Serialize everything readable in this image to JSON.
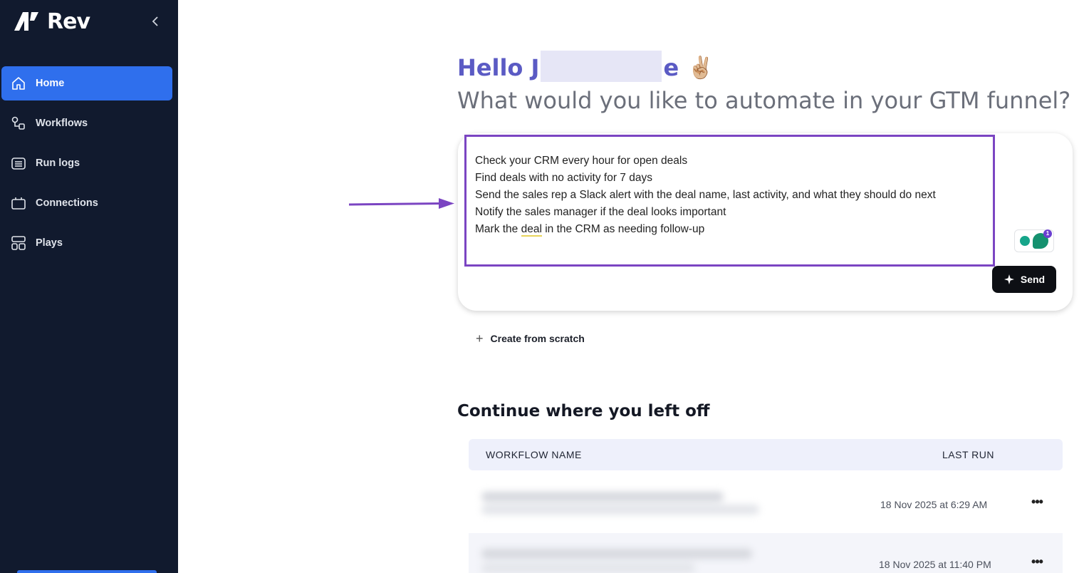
{
  "app": {
    "name": "Rev"
  },
  "sidebar": {
    "items": [
      {
        "label": "Home",
        "icon": "home-icon",
        "active": true
      },
      {
        "label": "Workflows",
        "icon": "workflow-icon",
        "active": false
      },
      {
        "label": "Run logs",
        "icon": "run-logs-icon",
        "active": false
      },
      {
        "label": "Connections",
        "icon": "connections-icon",
        "active": false
      },
      {
        "label": "Plays",
        "icon": "plays-icon",
        "active": false
      }
    ]
  },
  "greeting": {
    "prefix": "Hello J",
    "suffix": "e",
    "emoji": "✌🏼",
    "subtitle": "What would you like to automate in your GTM funnel?"
  },
  "prompt": {
    "lines": [
      "Check your CRM every hour for open deals",
      "Find deals with no activity for 7 days",
      "Send the sales rep a Slack alert with the deal name, last activity, and what they should do next",
      "Notify the sales manager if the deal looks important"
    ],
    "last_line_before": "Mark the ",
    "last_line_word": "deal",
    "last_line_after": " in the CRM as needing follow-up",
    "send_label": "Send",
    "grammarly_badge": "1"
  },
  "create_from_scratch": "Create from scratch",
  "continue_section": {
    "title": "Continue where you left off",
    "columns": {
      "name": "WORKFLOW NAME",
      "last_run": "LAST RUN"
    },
    "rows": [
      {
        "last_run": "18 Nov 2025 at 6:29 AM",
        "menu": "•••"
      },
      {
        "last_run": "18 Nov 2025 at 11:40 PM",
        "menu": "•••"
      }
    ]
  },
  "colors": {
    "sidebar_bg": "#111a2e",
    "active_nav": "#2f6fed",
    "greeting": "#5b5bc4",
    "prompt_border": "#7b45c2",
    "send_bg": "#0d0f14"
  }
}
